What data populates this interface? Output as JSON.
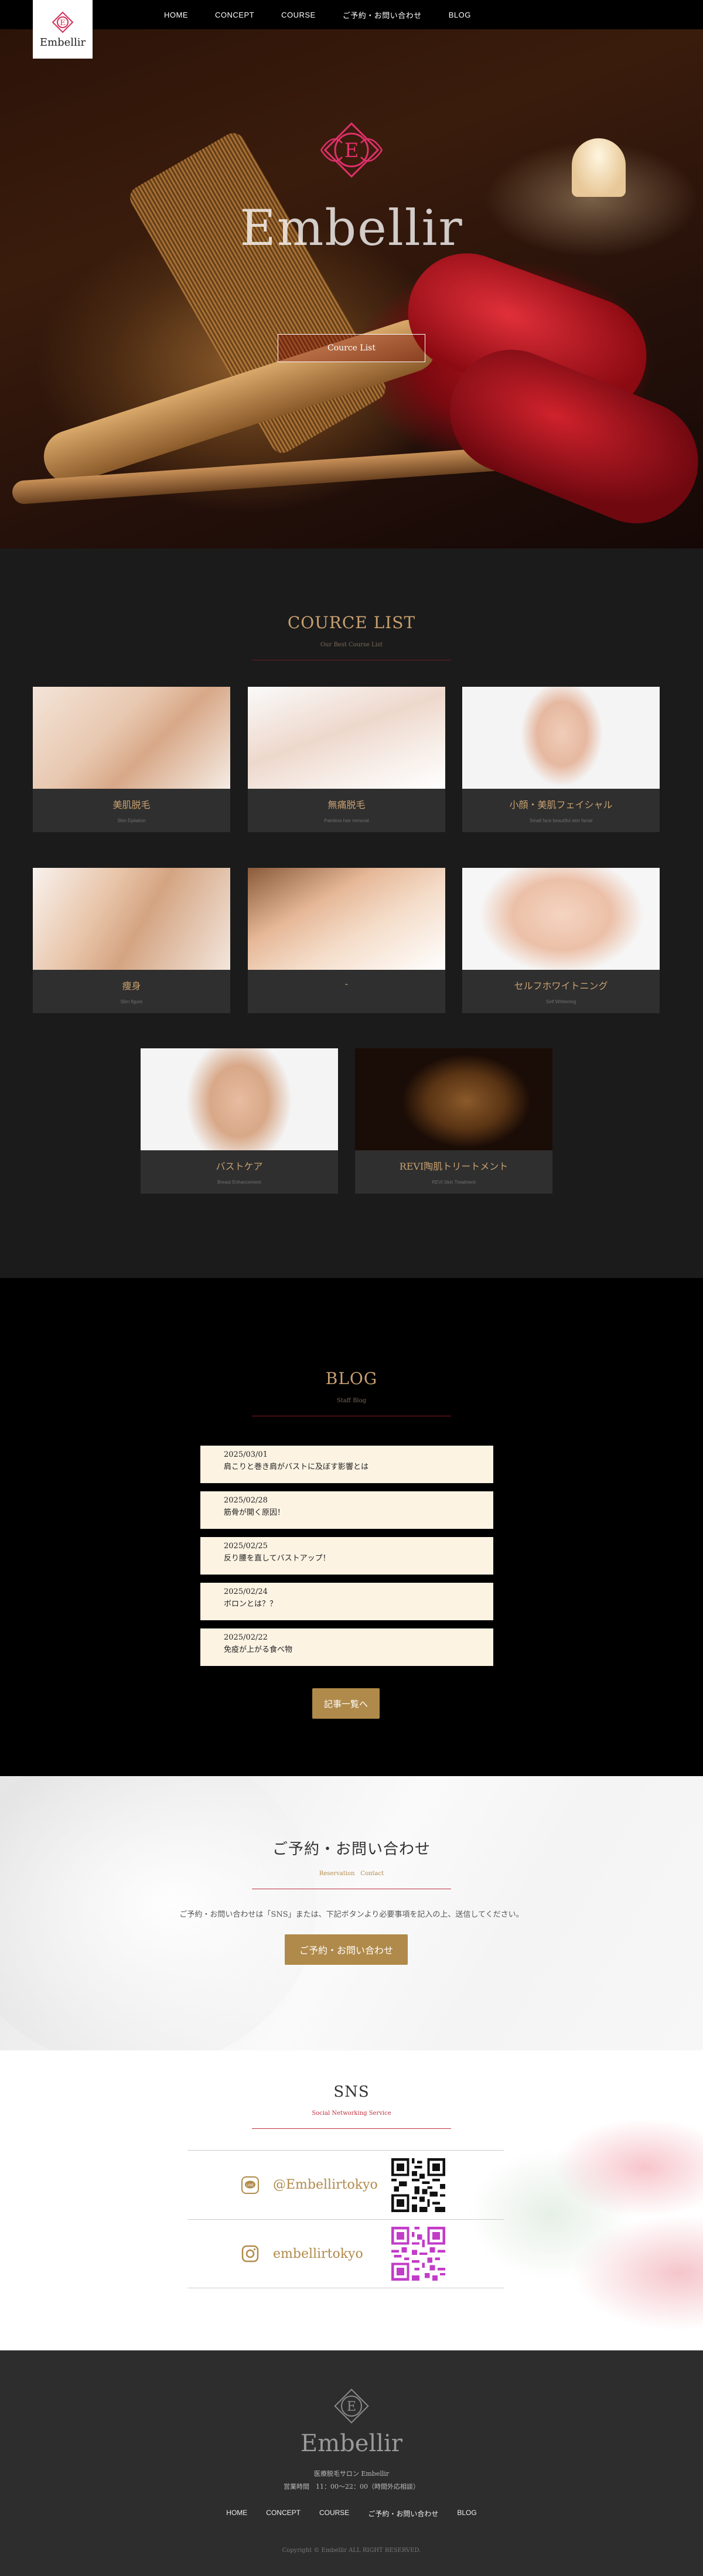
{
  "brand": {
    "name": "Embellir",
    "accent": "#b08a4a",
    "gold_text": "#c8a070",
    "red_line": "#c03040"
  },
  "nav": {
    "items": [
      {
        "label": "HOME"
      },
      {
        "label": "CONCEPT"
      },
      {
        "label": "COURSE"
      },
      {
        "label": "ご予約・お問い合わせ"
      },
      {
        "label": "BLOG"
      }
    ]
  },
  "hero": {
    "title": "Embellir",
    "button_label": "Cource List"
  },
  "courses": {
    "title": "COURCE LIST",
    "subtitle": "Our Best Course List",
    "items": [
      {
        "name": "美肌脱毛",
        "en": "Skin Epilation"
      },
      {
        "name": "無痛脱毛",
        "en": "Painless hair removal"
      },
      {
        "name": "小顔・美肌フェイシャル",
        "en": "Small face beautiful skin facial"
      },
      {
        "name": "痩身",
        "en": "Slim figure"
      },
      {
        "name": "-",
        "en": ""
      },
      {
        "name": "セルフホワイトニング",
        "en": "Self Whitening"
      },
      {
        "name": "バストケア",
        "en": "Breast Enhancement"
      },
      {
        "name": "REVI陶肌トリートメント",
        "en": "REVI Skin Treatment"
      }
    ]
  },
  "blog": {
    "title": "BLOG",
    "subtitle": "Staff Blog",
    "posts": [
      {
        "date": "2025/03/01",
        "title": "肩こりと巻き肩がバストに及ぼす影響とは"
      },
      {
        "date": "2025/02/28",
        "title": "筋骨が開く原因！"
      },
      {
        "date": "2025/02/25",
        "title": "反り腰を直してバストアップ！"
      },
      {
        "date": "2025/02/24",
        "title": "ボロンとは？？"
      },
      {
        "date": "2025/02/22",
        "title": "免疫が上がる食べ物"
      }
    ],
    "more_label": "記事一覧へ"
  },
  "contact": {
    "title": "ご予約・お問い合わせ",
    "subtitle": "Reservation　Contact",
    "text": "ご予約・お問い合わせは「SNS」または、下記ボタンより必要事項を記入の上、送信してください。",
    "button_label": "ご予約・お問い合わせ"
  },
  "sns": {
    "title": "SNS",
    "subtitle": "Social Networking Service",
    "accounts": [
      {
        "icon": "line-icon",
        "handle": "@Embellirtokyo"
      },
      {
        "icon": "instagram-icon",
        "handle": "embellirtokyo"
      }
    ]
  },
  "footer": {
    "title": "Embellir",
    "info_line1": "医療脱毛サロン Embellir",
    "info_line2": "営業時間　11：00〜22：00（時間外応相談）",
    "nav": [
      {
        "label": "HOME"
      },
      {
        "label": "CONCEPT"
      },
      {
        "label": "COURSE"
      },
      {
        "label": "ご予約・お問い合わせ"
      },
      {
        "label": "BLOG"
      }
    ],
    "copyright": "Copyright © Embellir ALL RIGHT RESERVED."
  }
}
